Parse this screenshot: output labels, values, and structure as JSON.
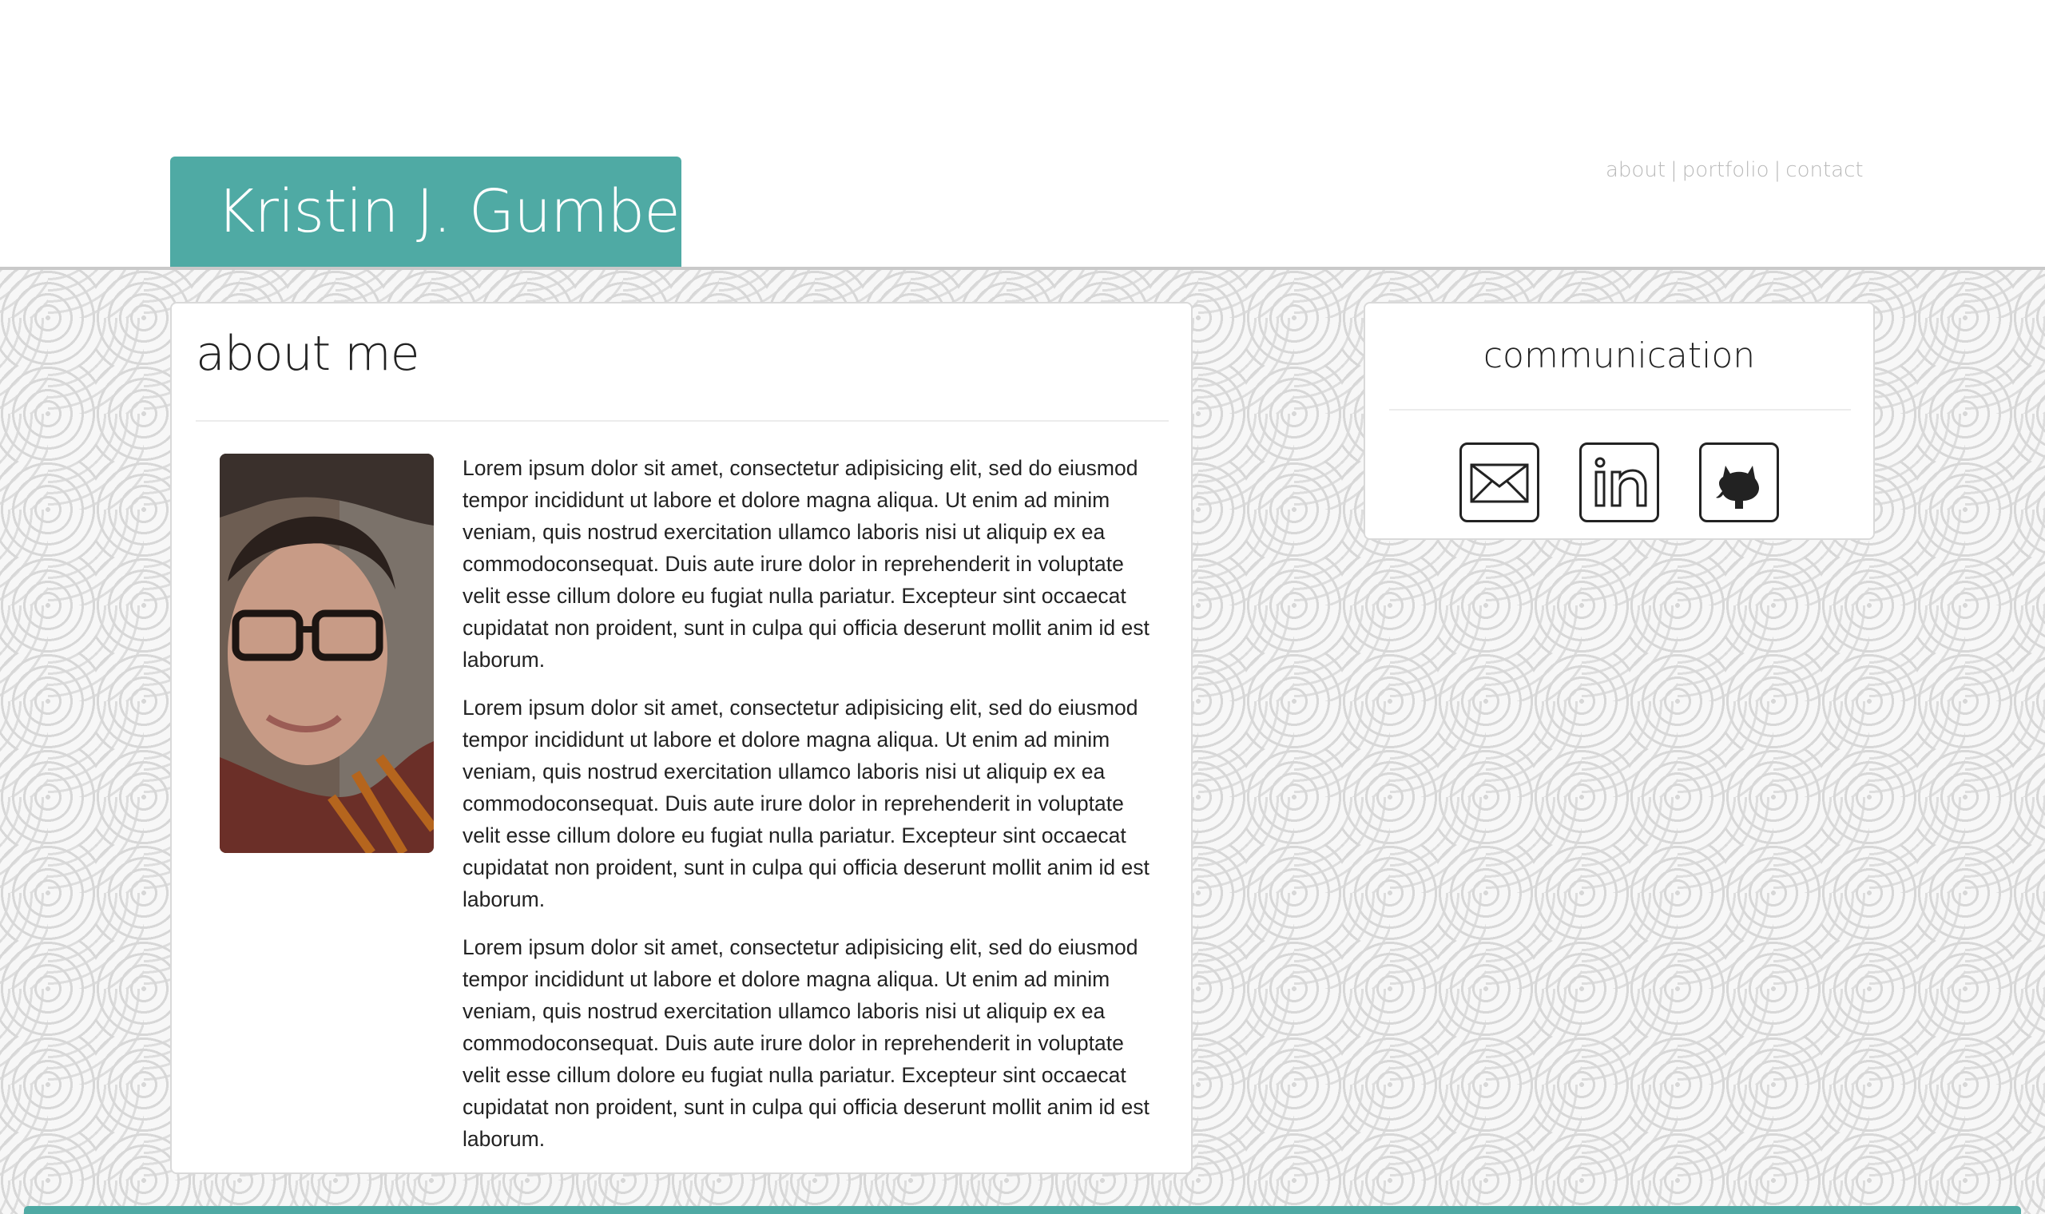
{
  "header": {
    "name": "Kristin J. Gumbert",
    "nav": [
      {
        "label": "about"
      },
      {
        "label": "portfolio"
      },
      {
        "label": "contact"
      }
    ],
    "separator": "|"
  },
  "about": {
    "title": "about me",
    "photo_icon": "portrait-photo",
    "paragraphs": [
      "Lorem ipsum dolor sit amet, consectetur adipisicing elit, sed do eiusmod tempor incididunt ut labore et dolore magna aliqua. Ut enim ad minim veniam, quis nostrud exercitation ullamco laboris nisi ut aliquip ex ea commodoconsequat. Duis aute irure dolor in reprehenderit in voluptate velit esse cillum dolore eu fugiat nulla pariatur. Excepteur sint occaecat cupidatat non proident, sunt in culpa qui officia deserunt mollit anim id est laborum.",
      "Lorem ipsum dolor sit amet, consectetur adipisicing elit, sed do eiusmod tempor incididunt ut labore et dolore magna aliqua. Ut enim ad minim veniam, quis nostrud exercitation ullamco laboris nisi ut aliquip ex ea commodoconsequat. Duis aute irure dolor in reprehenderit in voluptate velit esse cillum dolore eu fugiat nulla pariatur. Excepteur sint occaecat cupidatat non proident, sunt in culpa qui officia deserunt mollit anim id est laborum.",
      "Lorem ipsum dolor sit amet, consectetur adipisicing elit, sed do eiusmod tempor incididunt ut labore et dolore magna aliqua. Ut enim ad minim veniam, quis nostrud exercitation ullamco laboris nisi ut aliquip ex ea commodoconsequat. Duis aute irure dolor in reprehenderit in voluptate velit esse cillum dolore eu fugiat nulla pariatur. Excepteur sint occaecat cupidatat non proident, sunt in culpa qui officia deserunt mollit anim id est laborum."
    ]
  },
  "communication": {
    "title": "communication",
    "icons": [
      {
        "name": "mail-icon"
      },
      {
        "name": "linkedin-icon"
      },
      {
        "name": "github-icon"
      }
    ]
  },
  "colors": {
    "accent": "#4faaa4",
    "text": "#222222",
    "nav": "#b9b9b9"
  }
}
